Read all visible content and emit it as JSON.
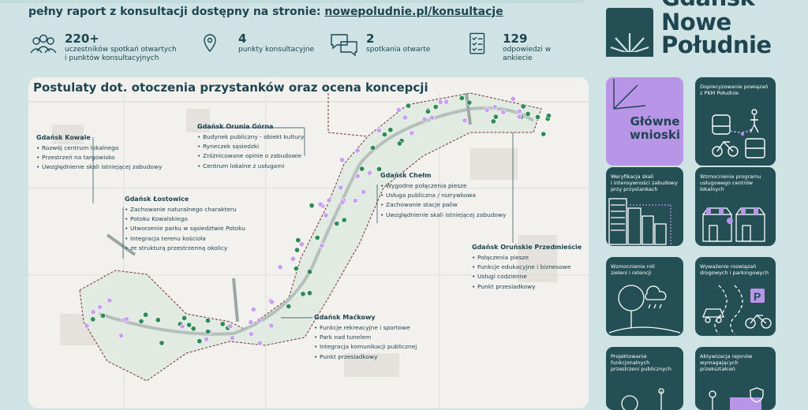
{
  "header": {
    "prefix": "pełny raport z konsultacji dostępny na stronie: ",
    "link": "nowepoludnie.pl/konsultacje"
  },
  "stats": [
    {
      "icon": "people-icon",
      "value": "220+",
      "label_lines": [
        "uczestników spotkań otwartych",
        "i punktów konsultacyjnych"
      ]
    },
    {
      "icon": "location-pin-icon",
      "value": "4",
      "label_lines": [
        "punkty konsultacyjne"
      ]
    },
    {
      "icon": "chat-bubbles-icon",
      "value": "2",
      "label_lines": [
        "spotkania otwarte"
      ]
    },
    {
      "icon": "checklist-icon",
      "value": "129",
      "label_lines": [
        "odpowiedzi w ankiecie"
      ]
    }
  ],
  "logo": {
    "icon": "gdansk-sun-logo-icon",
    "lines": [
      "Gdańsk",
      "Nowe",
      "Południe"
    ],
    "accent": "#1e4550"
  },
  "map": {
    "title": "Postulaty dot. otoczenia przystanków oraz ocena koncepcji",
    "districts": [
      {
        "name": "Gdańsk Kowale",
        "items": [
          "Rozwój centrum lokalnego",
          "Przestrzeń na targowisko",
          "Uwzględnienie skali istniejącej zabudowy"
        ]
      },
      {
        "name": "Gdańsk Orunia Górna",
        "items": [
          "Budynek publiczny - obiekt kultury",
          "Ryneczek sąsiedzki",
          "Zróżnicowane opinie o zabudowie",
          "Centrum lokalne z usługami"
        ]
      },
      {
        "name": "Gdańsk Łostowice",
        "items": [
          "Zachowanie naturalnego charakteru",
          "Potoku Kowalskiego",
          "Utworzenie parku w sąsiedztwie Potoku",
          "Integracja terenu kościoła",
          "ze strukturą przestrzenną okolicy"
        ]
      },
      {
        "name": "Gdańsk Chełm",
        "items": [
          "Wygodne połączenia piesze",
          "Usługa publiczna / rozrywkowa",
          "Zachowanie stacje paliw",
          "Uwzględnienie skali istniejącej zabudowy"
        ]
      },
      {
        "name": "Gdańsk Oruńskie Przedmieście",
        "items": [
          "Połączenia piesze",
          "Funkcje edukacyjne i biznesowe",
          "Usługi codzienne",
          "Punkt przesiadkowy"
        ]
      },
      {
        "name": "Gdańsk Maćkowy",
        "items": [
          "Funkcje rekreacyjne i sportowe",
          "Park nad tunelem",
          "Integracja komunikacji publicznej",
          "Punkt przesiadkowy"
        ]
      }
    ]
  },
  "conclusions": {
    "main_label_lines": [
      "Główne",
      "wnioski"
    ],
    "cards": [
      {
        "title_lines": [
          "Doprecyzowanie powiązań",
          "z PKM Południe"
        ],
        "icon": "train-bike-bus-pedestrian-icon"
      },
      {
        "title_lines": [
          "Weryfikacja skali",
          "i intensywności zabudowy",
          "przy przystankach"
        ],
        "icon": "buildings-icon"
      },
      {
        "title_lines": [
          "Wzmocnienie programu",
          "usługowego centrów",
          "lokalnych"
        ],
        "icon": "shops-icon"
      },
      {
        "title_lines": [
          "Wzmocnienie roli",
          "zieleni i retencji"
        ],
        "icon": "tree-rain-icon"
      },
      {
        "title_lines": [
          "Wyważenie rozwiązań",
          "drogowych i parkingowych"
        ],
        "icon": "car-parking-bike-icon"
      },
      {
        "title_lines": [
          "Projektowanie",
          "funkcjonalnych",
          "przestrzeni publicznych"
        ],
        "icon": "public-space-icon"
      },
      {
        "title_lines": [
          "Aktywizacja rejonów",
          "wymagających",
          "przekształceń"
        ],
        "icon": "people-activation-icon"
      }
    ]
  },
  "colors": {
    "background": "#cfe3e4",
    "dark_teal": "#234f55",
    "lilac": "#b995e7",
    "green_point": "#2e8a57",
    "purple_point": "#c9a2ef"
  }
}
